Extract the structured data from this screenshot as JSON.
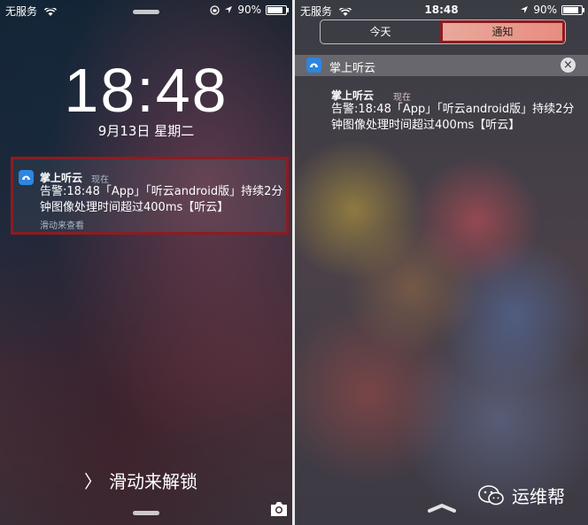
{
  "left": {
    "status": {
      "carrier": "无服务",
      "time": "",
      "battery": "90%",
      "battery_level": 0.9
    },
    "clock": "18:48",
    "date": "9月13日 星期二",
    "notification": {
      "app_name": "掌上听云",
      "timestamp": "现在",
      "message": "告警:18:48「App」「听云android版」持续2分钟图像处理时间超过400ms【听云】",
      "hint": "滑动来查看"
    },
    "unlock_prefix": "〉",
    "unlock_text": "滑动来解锁"
  },
  "right": {
    "status": {
      "carrier": "无服务",
      "time": "18:48",
      "battery": "90%",
      "battery_level": 0.9
    },
    "tabs": [
      {
        "label": "今天",
        "active": false
      },
      {
        "label": "通知",
        "active": true
      }
    ],
    "app_header": {
      "name": "掌上听云",
      "close": "×"
    },
    "notification": {
      "app_name": "掌上听云",
      "timestamp": "现在",
      "message": "告警:18:48「App」「听云android版」持续2分钟图像处理时间超过400ms【听云】"
    },
    "watermark": "运维帮"
  },
  "colors": {
    "highlight_border": "#8c1c22",
    "app_icon": "#2d86e0",
    "active_tab": "#e88c80"
  },
  "icons": [
    "wifi-icon",
    "rotation-lock-icon",
    "location-icon",
    "battery-icon",
    "app-icon",
    "camera-icon",
    "close-icon",
    "wechat-icon",
    "chevron-up-icon"
  ]
}
